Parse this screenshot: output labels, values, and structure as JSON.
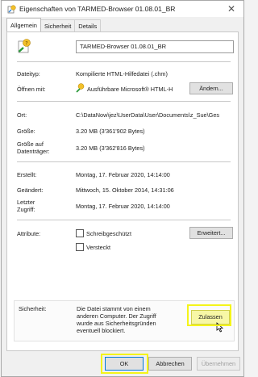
{
  "window": {
    "title": "Eigenschaften von TARMED-Browser 01.08.01_BR",
    "close_glyph": "✕"
  },
  "tabs": [
    {
      "label": "Allgemein",
      "active": true
    },
    {
      "label": "Sicherheit",
      "active": false
    },
    {
      "label": "Details",
      "active": false
    }
  ],
  "general": {
    "file_name": "TARMED-Browser 01.08.01_BR",
    "file_type_label": "Dateityp:",
    "file_type_value": "Kompilierte HTML-Hilfedatei (.chm)",
    "opens_with_label": "Öffnen mit:",
    "opens_with_value": "Ausführbare Microsoft® HTML-H",
    "change_button": "Ändern...",
    "location_label": "Ort:",
    "location_value": "C:\\DataNow\\jez\\UserData\\User\\Documents\\z_Sue\\Ges",
    "size_label": "Größe:",
    "size_value": "3.20 MB (3'361'902 Bytes)",
    "size_on_disk_label_1": "Größe auf",
    "size_on_disk_label_2": "Datenträger:",
    "size_on_disk_value": "3.20 MB (3'362'816 Bytes)",
    "created_label": "Erstellt:",
    "created_value": "Montag, 17. Februar 2020, 14:14:00",
    "modified_label": "Geändert:",
    "modified_value": "Mittwoch, 15. Oktober 2014, 14:31:06",
    "accessed_label_1": "Letzter",
    "accessed_label_2": "Zugriff:",
    "accessed_value": "Montag, 17. Februar 2020, 14:14:00",
    "attributes_label": "Attribute:",
    "readonly_label": "Schreibgeschützt",
    "readonly_checked": false,
    "hidden_label": "Versteckt",
    "hidden_checked": false,
    "advanced_button": "Erweitert...",
    "security_label": "Sicherheit:",
    "security_text_1": "Die Datei stammt von einem",
    "security_text_2": "anderen Computer. Der Zugriff",
    "security_text_3": "wurde aus Sicherheitsgründen",
    "security_text_4": "eventuell blockiert.",
    "unblock_button": "Zulassen"
  },
  "footer": {
    "ok_button": "OK",
    "cancel_button": "Abbrechen",
    "apply_button": "Übernehmen"
  },
  "colors": {
    "highlight": "#f4f41a",
    "window_bg": "#f0f0f0",
    "panel_bg": "#ffffff"
  }
}
